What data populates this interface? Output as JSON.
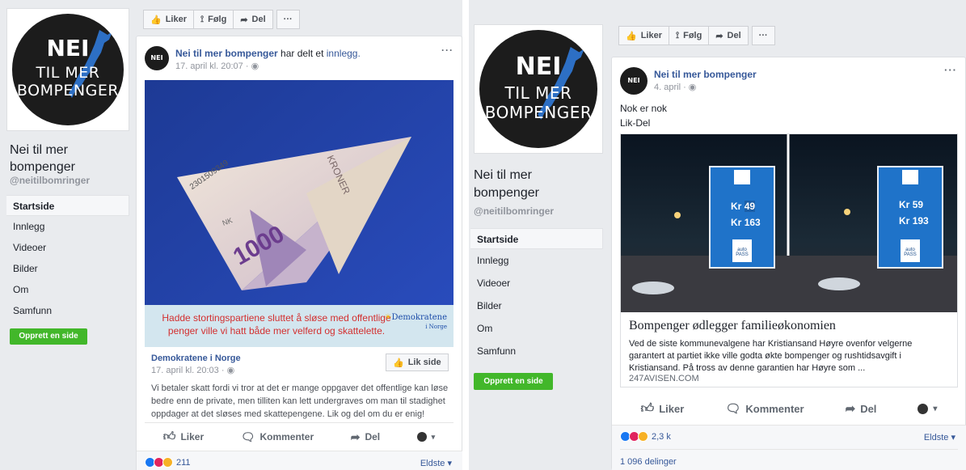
{
  "left": {
    "logo": {
      "big": "NEI",
      "line1": "TIL MER",
      "line2": "BOMPENGER"
    },
    "page_name": "Nei til mer bompenger",
    "handle": "@neitilbomringer",
    "nav": [
      "Startside",
      "Innlegg",
      "Videoer",
      "Bilder",
      "Om",
      "Samfunn"
    ],
    "create_page": "Opprett en side",
    "toolbar": {
      "like": "Liker",
      "follow": "Følg",
      "share": "Del",
      "more": "···"
    },
    "post": {
      "author": "Nei til mer bompenger",
      "action_pre": "har delt et",
      "action_link": "innlegg.",
      "time": "17. april kl. 20:07 · ",
      "dots": "···",
      "banner_text": "Hadde stortingspartiene sluttet å sløse med offentlige penger ville vi hatt både mer velferd og skattelette.",
      "banner_logo": "Demokratene",
      "banner_logo_sub": "i Norge",
      "note_1000": "1000",
      "note_serial": "2301509349",
      "note_kroner": "KRONER",
      "note_nk": "NK",
      "shared": {
        "author": "Demokratene i Norge",
        "time": "17. april kl. 20:03 · ",
        "like_page": "Lik side",
        "text": "Vi betaler skatt fordi vi tror at det er mange oppgaver det offentlige kan løse bedre enn de private, men tilliten kan lett undergraves om man til stadighet oppdager at det sløses med skattepengene. Lik og del om du er enig!"
      },
      "actions": {
        "like": "Liker",
        "comment": "Kommenter",
        "share": "Del"
      },
      "reactions_count": "211",
      "sort": "Eldste ▾"
    }
  },
  "right": {
    "logo": {
      "big": "NEI",
      "line1": "TIL MER",
      "line2": "BOMPENGER"
    },
    "page_name": "Nei til mer bompenger",
    "handle": "@neitilbomringer",
    "nav": [
      "Startside",
      "Innlegg",
      "Videoer",
      "Bilder",
      "Om",
      "Samfunn"
    ],
    "create_page": "Opprett en side",
    "toolbar": {
      "like": "Liker",
      "follow": "Følg",
      "share": "Del",
      "more": "···"
    },
    "post": {
      "author": "Nei til mer bompenger",
      "time": "4. april · ",
      "dots": "···",
      "text1": "Nok er nok",
      "text2": "Lik-Del",
      "sign_kr1_left": "Kr",
      "sign_val1_left": "49",
      "sign_kr2_left": "Kr",
      "sign_val2_left": "163",
      "sign_kr1_right": "Kr",
      "sign_val1_right": "59",
      "sign_kr2_right": "Kr",
      "sign_val2_right": "193",
      "autopass": "auto PASS",
      "link_title": "Bompenger ødlegger familieøkonomien",
      "link_desc": "Ved de siste kommunevalgene har Kristiansand Høyre ovenfor velgerne garantert at partiet ikke ville godta økte bompenger og rushtidsavgift i Kristiansand. På tross av denne garantien har Høyre som ...",
      "link_source": "247AVISEN.COM",
      "actions": {
        "like": "Liker",
        "comment": "Kommenter",
        "share": "Del"
      },
      "reactions_count": "2,3 k",
      "sort": "Eldste ▾",
      "shares": "1 096 delinger"
    }
  }
}
